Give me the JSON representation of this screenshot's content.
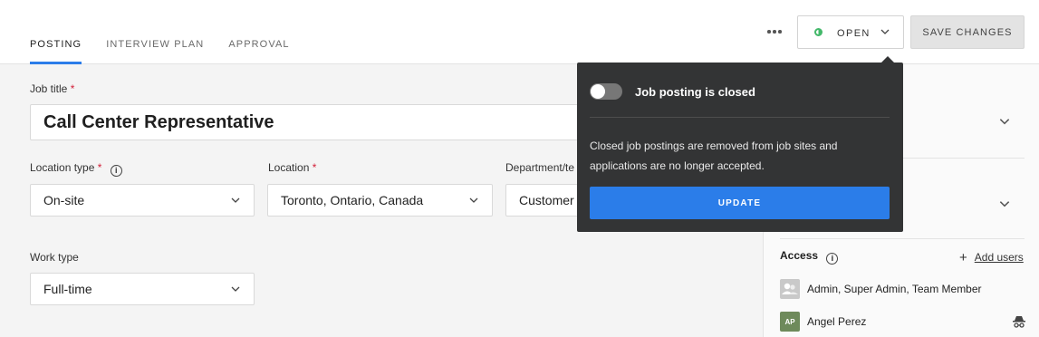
{
  "tabs": [
    {
      "label": "POSTING",
      "active": true
    },
    {
      "label": "INTERVIEW PLAN",
      "active": false
    },
    {
      "label": "APPROVAL",
      "active": false
    }
  ],
  "header": {
    "status_label": "OPEN",
    "save_label": "SAVE CHANGES",
    "more_icon": "more-horizontal-icon"
  },
  "form": {
    "job_title": {
      "label": "Job title",
      "required": "*",
      "value": "Call Center Representative"
    },
    "location_type": {
      "label": "Location type",
      "required": "*",
      "value": "On-site"
    },
    "location": {
      "label": "Location",
      "required": "*",
      "value": "Toronto, Ontario, Canada"
    },
    "department": {
      "label": "Department/te",
      "value": "Customer S"
    },
    "work_type": {
      "label": "Work type",
      "value": "Full-time"
    }
  },
  "popover": {
    "toggle_on": false,
    "title": "Job posting is closed",
    "description": "Closed job postings are removed from job sites and applications are no longer accepted.",
    "update_label": "UPDATE"
  },
  "access": {
    "title": "Access",
    "add_users_label": "Add users",
    "members": [
      {
        "name": "Admin, Super Admin, Team Member",
        "avatar_icon": "group-icon"
      },
      {
        "name": "Angel Perez",
        "initials": "AP"
      }
    ]
  },
  "colors": {
    "accent": "#2b7de9",
    "open_status": "#43b86a",
    "popover_bg": "#333435",
    "required": "#d3213a"
  }
}
